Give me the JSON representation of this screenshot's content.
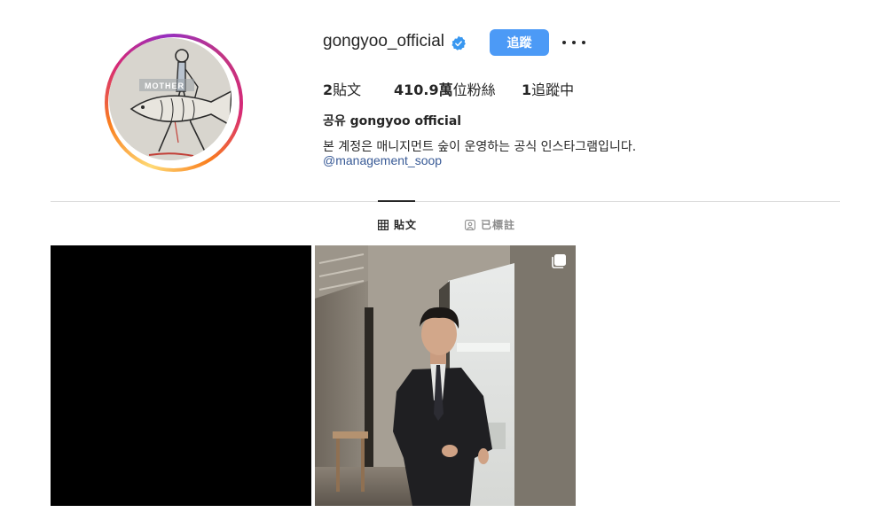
{
  "profile": {
    "username": "gongyoo_official",
    "follow_label": "追蹤",
    "avatar_brand": "MOTHER",
    "stats": {
      "posts_count": "2",
      "posts_label": "貼文",
      "followers_count": "410.9萬",
      "followers_label": "位粉絲",
      "following_count": "1",
      "following_label": "追蹤中"
    },
    "full_name": "공유 gongyoo official",
    "bio": "본 계정은 매니지먼트 숲이 운영하는 공식 인스타그램입니다.",
    "bio_link": "@management_soop"
  },
  "tabs": {
    "posts_label": "貼文",
    "tagged_label": "已標註"
  },
  "colors": {
    "follow_button": "#4c9af6",
    "verified_badge": "#3897f0",
    "link": "#385a96"
  },
  "icons": {
    "verified": "verified-badge-icon",
    "more": "ellipsis-icon",
    "posts_tab": "grid-icon",
    "tagged_tab": "person-tag-icon",
    "multi_post": "carousel-icon"
  }
}
